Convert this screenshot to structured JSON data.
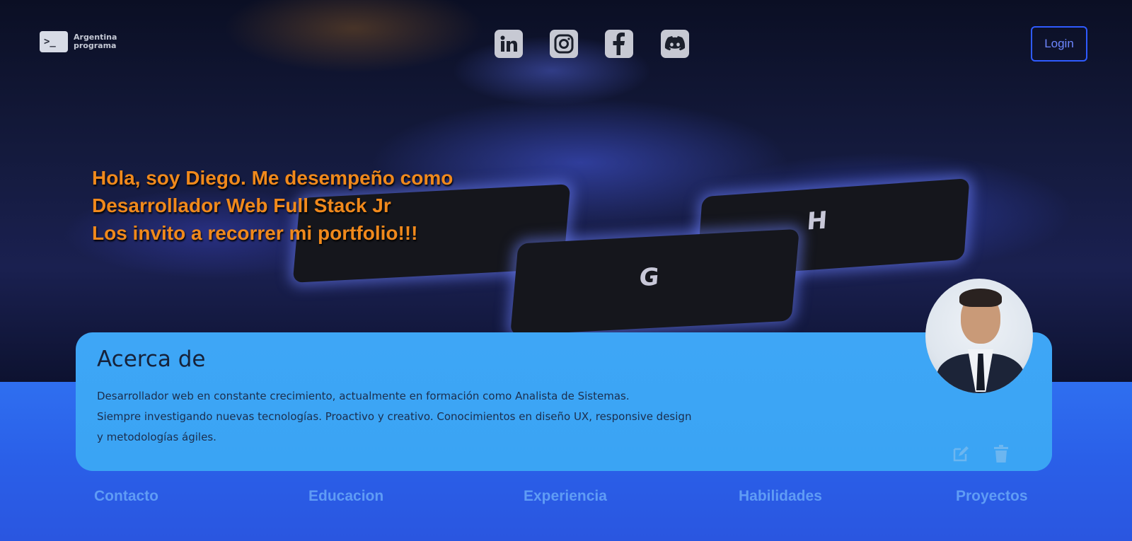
{
  "brand": {
    "logo_glyph": ">_",
    "line1": "Argentina",
    "line2": "programa"
  },
  "social": [
    {
      "name": "linkedin",
      "icon": "linkedin-icon"
    },
    {
      "name": "instagram",
      "icon": "instagram-icon"
    },
    {
      "name": "facebook",
      "icon": "facebook-icon"
    },
    {
      "name": "discord",
      "icon": "discord-icon"
    }
  ],
  "header": {
    "login_label": "Login"
  },
  "hero": {
    "line1": "Hola, soy Diego. Me desempeño como",
    "line2": "Desarrollador Web Full Stack Jr",
    "line3": "Los invito a recorrer mi portfolio!!!",
    "keys": [
      "G",
      "H"
    ]
  },
  "about": {
    "title": "Acerca de",
    "line1": "Desarrollador web en constante crecimiento, actualmente en formación como Analista de Sistemas.",
    "line2": "Siempre investigando nuevas tecnologías. Proactivo y creativo. Conocimientos en diseño UX, responsive design",
    "line3": "y metodologías ágiles.",
    "edit_icon": "edit-icon",
    "delete_icon": "trash-icon"
  },
  "sections": [
    "Contacto",
    "Educacion",
    "Experiencia",
    "Habilidades",
    "Proyectos"
  ],
  "colors": {
    "accent_orange": "#f0891c",
    "card_blue": "#3ea6f6",
    "login_border": "#2f5bff",
    "section_link": "#5f9cf5"
  }
}
